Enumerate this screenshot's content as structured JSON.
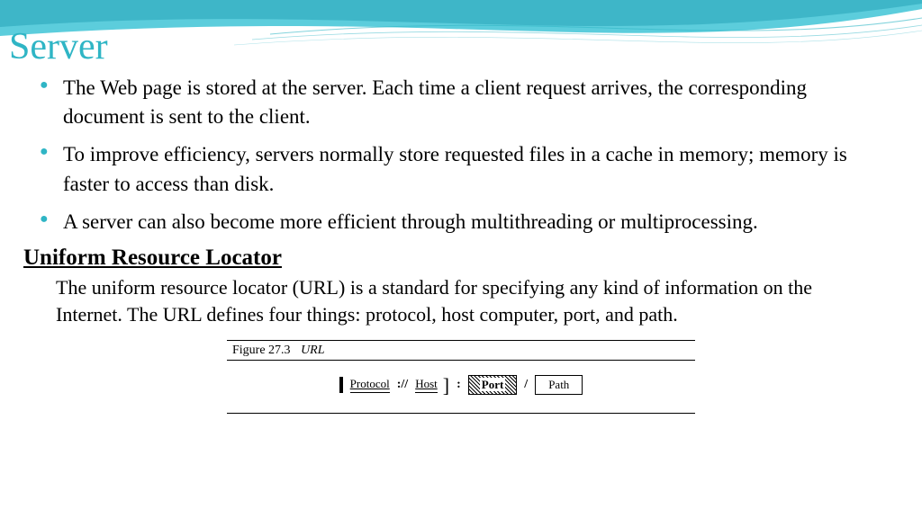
{
  "title": "Server",
  "bullets": [
    "The Web page is stored at the server. Each time a client request arrives, the corresponding document is sent to the client.",
    "To improve efficiency, servers normally store requested files in a cache in memory; memory is faster to access than disk.",
    "A server can also become more efficient through multithreading or multiprocessing."
  ],
  "subheading": "Uniform Resource Locator",
  "subtext": "The uniform resource locator (URL) is a standard for specifying any kind of information on the Internet. The URL defines four things: protocol, host computer, port, and path.",
  "figure": {
    "number": "Figure 27.3",
    "title": "URL",
    "parts": {
      "protocol": "Protocol",
      "sep1": "://",
      "host": "Host",
      "colon": ":",
      "port": "Port",
      "slash": "/",
      "path": "Path"
    }
  }
}
